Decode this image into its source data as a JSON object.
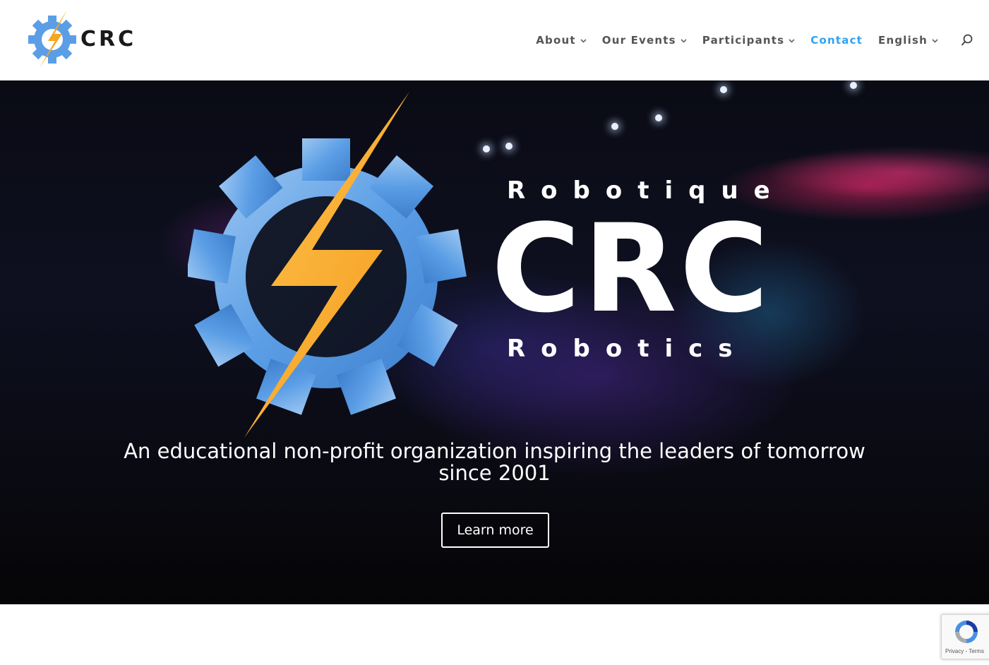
{
  "brand": {
    "logo_text": "CRC"
  },
  "nav": {
    "items": [
      {
        "label": "About",
        "has_dropdown": true
      },
      {
        "label": "Our Events",
        "has_dropdown": true
      },
      {
        "label": "Participants",
        "has_dropdown": true
      },
      {
        "label": "Contact",
        "has_dropdown": false,
        "active": true
      },
      {
        "label": "English",
        "has_dropdown": true
      }
    ],
    "chevron_glyph": "⌄",
    "search_icon": "search-icon",
    "active_color": "#2ea3f2"
  },
  "hero": {
    "top_word": "Robotique",
    "big_word": "CRC",
    "bottom_word": "Robotics",
    "tagline": "An educational non-profit organization inspiring the leaders of tomorrow since 2001",
    "cta_label": "Learn more"
  },
  "recaptcha": {
    "links": "Privacy - Terms"
  },
  "colors": {
    "gear_blue": "#4a90d9",
    "bolt_orange": "#f5a623"
  }
}
